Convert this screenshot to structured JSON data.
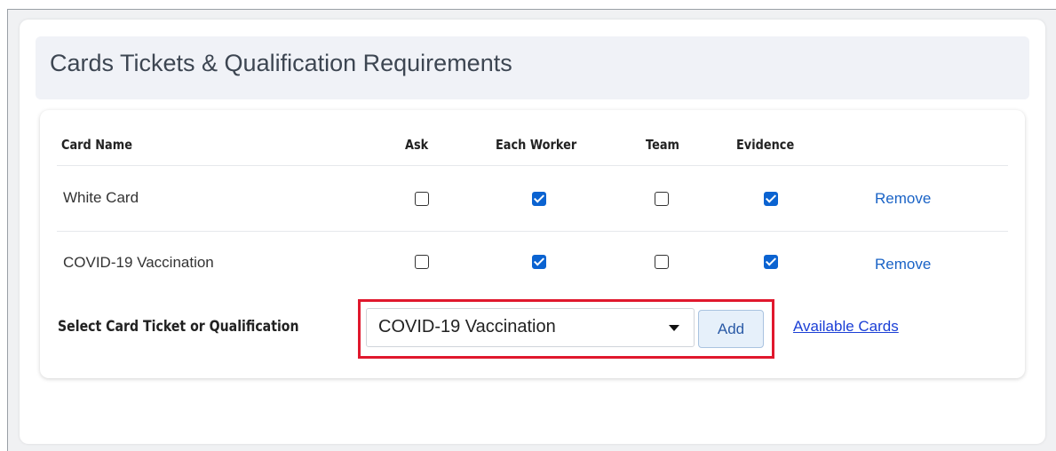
{
  "section": {
    "title": "Cards Tickets & Qualification Requirements"
  },
  "table": {
    "headers": {
      "card_name": "Card Name",
      "ask": "Ask",
      "each_worker": "Each Worker",
      "team": "Team",
      "evidence": "Evidence"
    },
    "rows": [
      {
        "name": "White Card",
        "ask": false,
        "each_worker": true,
        "team": false,
        "evidence": true,
        "action": "Remove"
      },
      {
        "name": "COVID-19 Vaccination",
        "ask": false,
        "each_worker": true,
        "team": false,
        "evidence": true,
        "action": "Remove"
      }
    ]
  },
  "selector": {
    "label": "Select Card Ticket or Qualification",
    "selected": "COVID-19 Vaccination",
    "add_label": "Add",
    "available_link": "Available Cards"
  },
  "colors": {
    "checkbox_checked": "#0b63d1",
    "link": "#1a63c6",
    "highlight": "#e0182d",
    "header_band": "#f0f2f7"
  },
  "icons": {
    "dropdown": "caret-down-icon"
  }
}
